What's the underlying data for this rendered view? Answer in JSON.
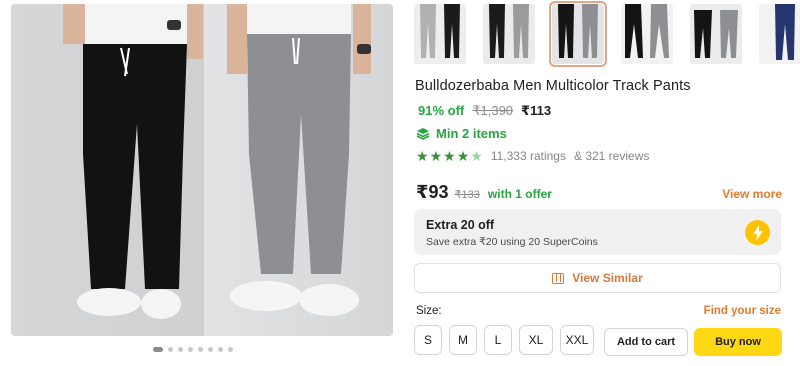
{
  "gallery": {
    "image_count": 8,
    "active_index": 0
  },
  "thumbnails": [
    {
      "name": "grey-black-pair",
      "selected": false
    },
    {
      "name": "black-grey-pair",
      "selected": false
    },
    {
      "name": "black-grey-pair-front",
      "selected": true
    },
    {
      "name": "black-grey-walking",
      "selected": false
    },
    {
      "name": "black-grey-seated",
      "selected": false
    },
    {
      "name": "navy-pants",
      "selected": false
    }
  ],
  "product": {
    "title": "Bulldozerbaba Men Multicolor Track Pants",
    "discount": "91% off",
    "mrp": "₹1,390",
    "price": "₹113",
    "min_items": "Min 2 items",
    "rating_stars": 4,
    "ratings": "11,333 ratings",
    "reviews": "& 321 reviews"
  },
  "offer": {
    "price": "₹93",
    "mrp": "₹133",
    "text": "with 1 offer",
    "view_more": "View more"
  },
  "coins": {
    "title": "Extra 20 off",
    "subtitle": "Save extra ₹20 using 20 SuperCoins",
    "icon": "lightning-icon"
  },
  "view_similar": "View Similar",
  "size": {
    "label": "Size:",
    "find_size": "Find your size",
    "options": [
      "S",
      "M",
      "L",
      "XL",
      "XXL"
    ]
  },
  "actions": {
    "add_to_cart": "Add to cart",
    "buy_now": "Buy now"
  },
  "colors": {
    "green": "#26a541",
    "orange": "#e67a2b",
    "yellow": "#ffd814",
    "coin": "#ffc200"
  }
}
